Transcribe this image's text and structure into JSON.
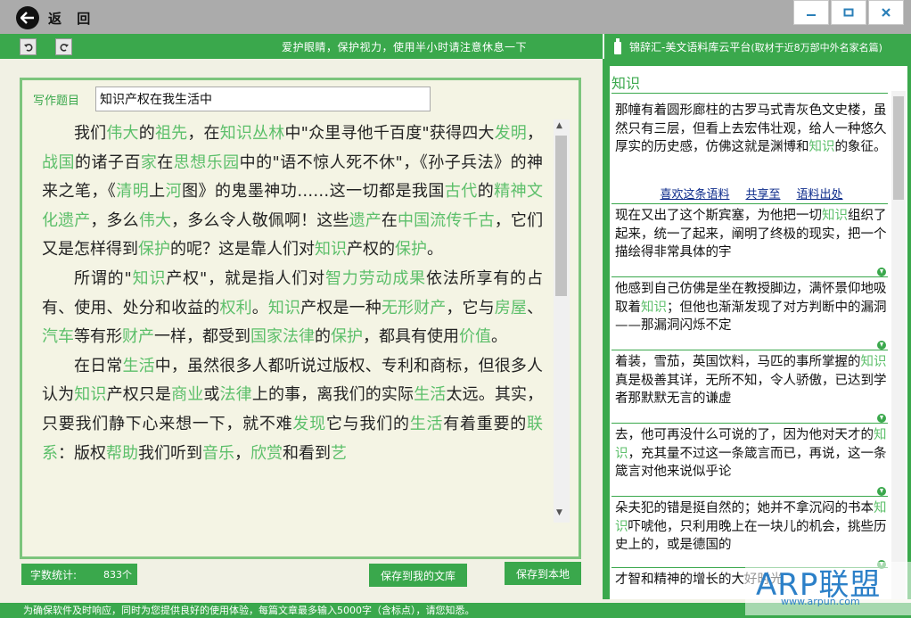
{
  "titlebar": {
    "back_label": "返 回",
    "minimize_icon": "minimize-icon",
    "maximize_icon": "maximize-icon",
    "close_icon": "close-icon"
  },
  "toolbar": {
    "notice": "爱护眼睛，保护视力，使用半小时请注意休息一下",
    "brand": "锦辞汇-美文语料库云平台",
    "brand_sub": "(取材于近8万部中外名家名篇)"
  },
  "editor": {
    "title_label": "写作题目",
    "title_value": "知识产权在我生活中",
    "paragraphs": [
      [
        [
          "我们",
          ""
        ],
        [
          "伟大",
          "kw"
        ],
        [
          "的",
          ""
        ],
        [
          "祖先",
          "kw"
        ],
        [
          "，在",
          ""
        ],
        [
          "知识丛林",
          "kw"
        ],
        [
          "中\"众里寻他千百度\"获得四大",
          ""
        ],
        [
          "发明",
          "kw"
        ],
        [
          "，",
          ""
        ],
        [
          "战国",
          "kw"
        ],
        [
          "的诸子百",
          ""
        ],
        [
          "家",
          "kw"
        ],
        [
          "在",
          ""
        ],
        [
          "思想乐园",
          "kw"
        ],
        [
          "中的\"语不惊人死不休\"，《孙子兵法》的神来之笔，《",
          ""
        ],
        [
          "清明",
          "kw"
        ],
        [
          "上",
          ""
        ],
        [
          "河",
          "kw"
        ],
        [
          "图》的鬼墨神功……这一切都是我国",
          ""
        ],
        [
          "古代",
          "kw"
        ],
        [
          "的",
          ""
        ],
        [
          "精神文化遗产",
          "kw"
        ],
        [
          "，多么",
          ""
        ],
        [
          "伟大",
          "kw"
        ],
        [
          "，多么令人敬佩啊！这些",
          ""
        ],
        [
          "遗产",
          "kw"
        ],
        [
          "在",
          ""
        ],
        [
          "中国流传千古",
          "kw"
        ],
        [
          "，它们又是怎样得到",
          ""
        ],
        [
          "保护",
          "kw"
        ],
        [
          "的呢？这是靠人们对",
          ""
        ],
        [
          "知识",
          "kw"
        ],
        [
          "产权的",
          ""
        ],
        [
          "保护",
          "kw"
        ],
        [
          "。",
          ""
        ]
      ],
      [
        [
          "所谓的\"",
          ""
        ],
        [
          "知识",
          "kw"
        ],
        [
          "产权\"，就是指人们对",
          ""
        ],
        [
          "智力劳动成果",
          "kw"
        ],
        [
          "依法所享有的占有、使用、处分和收益的",
          ""
        ],
        [
          "权利",
          "kw"
        ],
        [
          "。",
          ""
        ],
        [
          "知识",
          "kw"
        ],
        [
          "产权是一种",
          ""
        ],
        [
          "无形财产",
          "kw"
        ],
        [
          "，它与",
          ""
        ],
        [
          "房屋",
          "kw"
        ],
        [
          "、",
          ""
        ],
        [
          "汽车",
          "kw"
        ],
        [
          "等有形",
          ""
        ],
        [
          "财产",
          "kw"
        ],
        [
          "一样，都受到",
          ""
        ],
        [
          "国家法律",
          "kw"
        ],
        [
          "的",
          ""
        ],
        [
          "保护",
          "kw"
        ],
        [
          "，都具有使用",
          ""
        ],
        [
          "价值",
          "kw"
        ],
        [
          "。",
          ""
        ]
      ],
      [
        [
          "在日常",
          ""
        ],
        [
          "生活",
          "kw"
        ],
        [
          "中，虽然很多人都听说过版权、专利和商标，但很多人认为",
          ""
        ],
        [
          "知识",
          "kw"
        ],
        [
          "产权只是",
          ""
        ],
        [
          "商业",
          "kw"
        ],
        [
          "或",
          ""
        ],
        [
          "法律",
          "kw"
        ],
        [
          "上的事，离我们的实际",
          ""
        ],
        [
          "生活",
          "kw"
        ],
        [
          "太远。其实，只要我们静下心来想一下，就不难",
          ""
        ],
        [
          "发现",
          "kw"
        ],
        [
          "它与我们的",
          ""
        ],
        [
          "生活",
          "kw"
        ],
        [
          "有着重要的",
          ""
        ],
        [
          "联系",
          "kw"
        ],
        [
          "：版权",
          ""
        ],
        [
          "帮助",
          "kw"
        ],
        [
          "我们听到",
          ""
        ],
        [
          "音乐",
          "kw"
        ],
        [
          "，",
          ""
        ],
        [
          "欣赏",
          "kw"
        ],
        [
          "和看到",
          ""
        ],
        [
          "艺",
          "kw"
        ]
      ]
    ],
    "count_label": "字数统计:",
    "count_value": "833个",
    "save_library": "保存到我的文库",
    "save_local": "保存到本地"
  },
  "right_panel": {
    "heading": "知识",
    "cards": [
      [
        [
          "那幢有着圆形廊柱的古罗马式青灰色文史楼，虽然只有三层，但看上去宏伟壮观，给人一种悠久厚实的历史感，仿佛这就是渊博和",
          ""
        ],
        [
          "知识",
          "kw"
        ],
        [
          "的象征。",
          ""
        ]
      ],
      [
        [
          "现在又出了这个斯宾塞，为他把一切",
          ""
        ],
        [
          "知识",
          "kw"
        ],
        [
          "组织了起来，统一了起来，阐明了终极的现实，把一个描绘得非常具体的宇",
          ""
        ]
      ],
      [
        [
          "他感到自己仿佛是坐在教授脚边，满怀景仰地吸取着",
          ""
        ],
        [
          "知识",
          "kw"
        ],
        [
          "；但他也渐渐发现了对方判断中的漏洞——那漏洞闪烁不定",
          ""
        ]
      ],
      [
        [
          "着装，雪茄，英国饮料，马匹的事所掌握的",
          ""
        ],
        [
          "知识",
          "kw"
        ],
        [
          "真是极善其详，无所不知，令人骄傲，已达到学者那默默无言的谦虚",
          ""
        ]
      ],
      [
        [
          "去，他可再没什么可说的了，因为他对天才的",
          ""
        ],
        [
          "知识",
          "kw"
        ],
        [
          "，充其量不过这一条箴言而已，再说，这一条箴言对他来说似乎论",
          ""
        ]
      ],
      [
        [
          "朵夫犯的错是挺自然的；她并不拿沉闷的书本",
          ""
        ],
        [
          "知识",
          "kw"
        ],
        [
          "吓唬他，只利用晚上在一块儿的机会，挑些历史上的，或是德国的",
          ""
        ]
      ],
      [
        [
          "才智和精神的增长",
          ""
        ],
        [
          "的大好时光",
          ""
        ]
      ]
    ],
    "links": [
      "喜欢这条语料",
      "共享至",
      "语料出处"
    ]
  },
  "statusbar": {
    "text": "为确保软件及时响应，同时为您提供良好的使用体验，每篇文章最多输入5000字（含标点），请您知悉。"
  },
  "watermark": {
    "big": "ARP联盟",
    "small": "www.arpun.com"
  }
}
